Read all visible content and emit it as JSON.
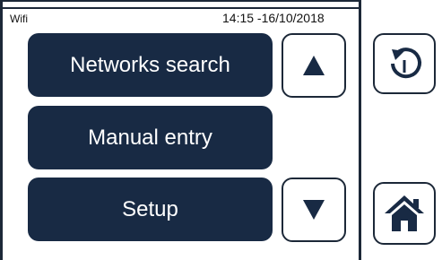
{
  "status": {
    "title": "Wifi",
    "datetime": "14:15 -16/10/2018"
  },
  "menu": {
    "networks_search": "Networks search",
    "manual_entry": "Manual entry",
    "setup": "Setup"
  },
  "icons": {
    "scroll_up": "triangle-up-icon",
    "scroll_down": "triangle-down-icon",
    "back": "back-arrow-icon",
    "home": "home-icon"
  },
  "colors": {
    "primary": "#182a44",
    "background": "#ffffff",
    "text_on_primary": "#ffffff"
  }
}
